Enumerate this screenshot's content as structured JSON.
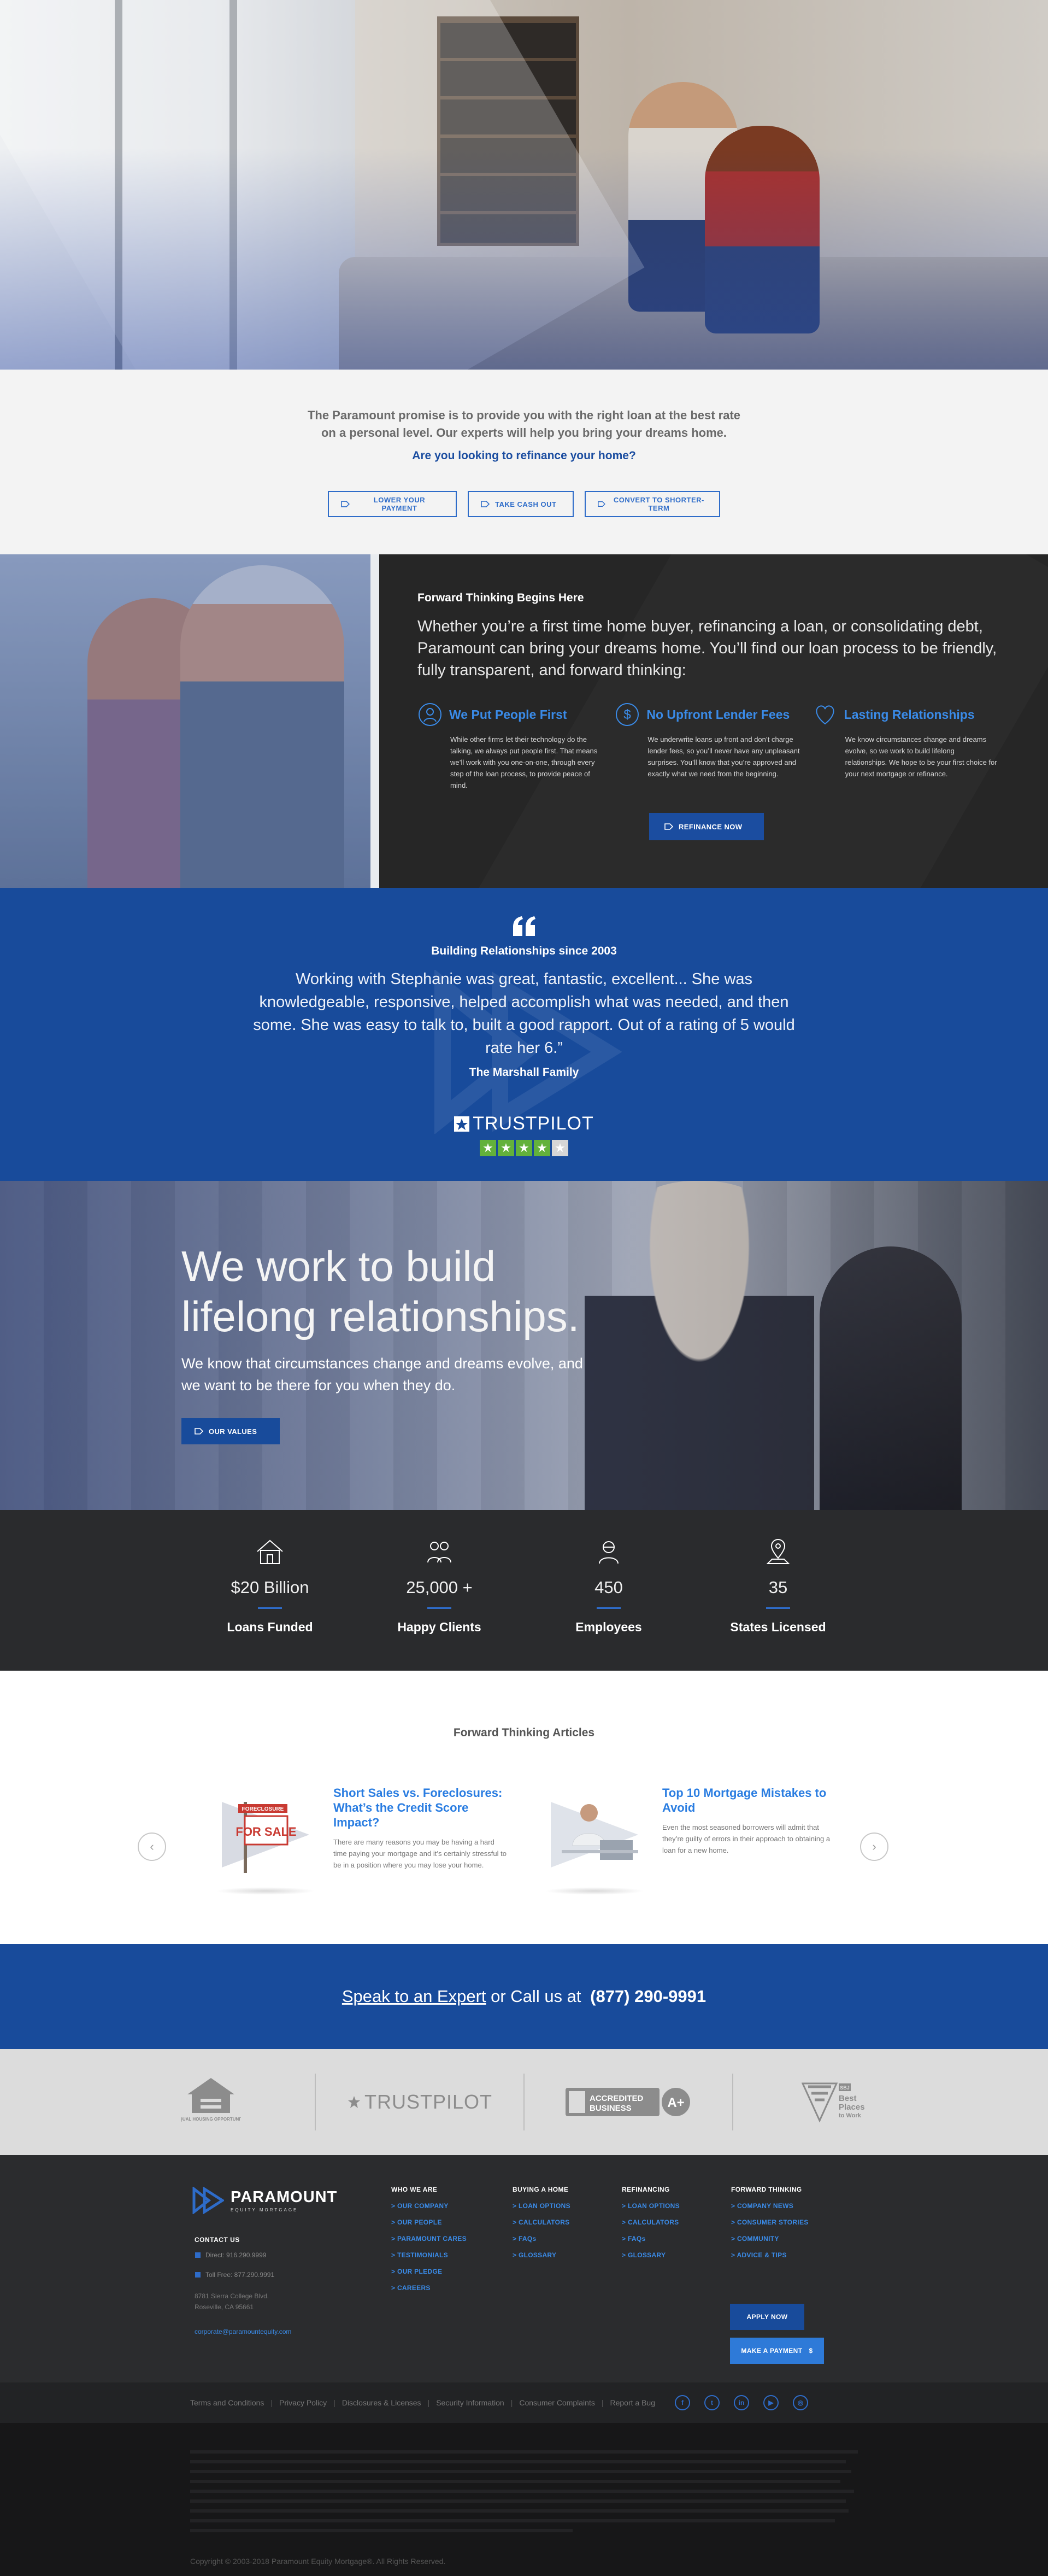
{
  "promise": {
    "text": "The Paramount promise is to provide you with the right loan at the best rate on a personal level. Our experts will help you bring your dreams home.",
    "question": "Are you looking to refinance your home?",
    "buttons": [
      "LOWER YOUR PAYMENT",
      "TAKE CASH OUT",
      "CONVERT TO SHORTER-TERM"
    ]
  },
  "forward": {
    "heading": "Forward Thinking Begins Here",
    "lead": "Whether you’re a first time home buyer, refinancing a loan, or consolidating debt, Paramount can bring your dreams home. You’ll find our loan process to be friendly, fully transparent, and forward thinking:",
    "columns": [
      {
        "title": "We Put People First",
        "icon": "people-icon",
        "text": "While other firms let their technology do the talking, we always put people first. That means we’ll work with you one-on-one, through every step of the loan process, to provide peace of mind."
      },
      {
        "title": "No Upfront Lender Fees",
        "icon": "dollar-icon",
        "text": "We underwrite loans up front and don’t charge lender fees, so you’ll never have any unpleasant surprises. You’ll know that you’re approved and exactly what we need from the beginning."
      },
      {
        "title": "Lasting Relationships",
        "icon": "heart-icon",
        "text": "We know circumstances change and dreams evolve, so we work to build lifelong relationships. We hope to be your first choice for your next mortgage or refinance."
      }
    ],
    "button": "REFINANCE NOW"
  },
  "testimonial": {
    "heading": "Building Relationships since 2003",
    "quote": "Working with Stephanie was great, fantastic, excellent... She was knowledgeable, responsive, helped accomplish what was needed, and then some. She was easy to talk to, built a good rapport. Out of a rating of 5 would rate her 6.”",
    "author": "The Marshall Family",
    "trustpilot": "TRUSTPILOT",
    "rating": 4,
    "rating_max": 5,
    "star_color": "#63b13b"
  },
  "relations": {
    "title_line1": "We work to build",
    "title_line2": "lifelong relationships.",
    "text": "We know that circumstances change and dreams evolve, and we want to be there for you when they do.",
    "button": "OUR VALUES"
  },
  "stats": [
    {
      "icon": "house-icon",
      "value": "$20 Billion",
      "label": "Loans Funded"
    },
    {
      "icon": "clients-icon",
      "value": "25,000 +",
      "label": "Happy Clients"
    },
    {
      "icon": "employee-icon",
      "value": "450",
      "label": "Employees"
    },
    {
      "icon": "map-pin-icon",
      "value": "35",
      "label": "States Licensed"
    }
  ],
  "articles": {
    "heading": "Forward Thinking Articles",
    "items": [
      {
        "title": "Short Sales vs. Foreclosures: What’s the Credit Score Impact?",
        "excerpt": "There are many reasons you may be having a hard time paying your mortgage and it’s certainly stressful to be in a position where you may lose your home.",
        "sign_top": "FORECLOSURE",
        "sign_main": "FOR SALE"
      },
      {
        "title": "Top 10 Mortgage Mistakes to Avoid",
        "excerpt": "Even the most seasoned borrowers will admit that they’re guilty of errors in their approach to obtaining a loan for a new home."
      }
    ]
  },
  "cta": {
    "link": "Speak to an Expert",
    "middle": " or Call us at ",
    "phone": "(877) 290-9991"
  },
  "badges": {
    "eho": "EQUAL HOUSING OPPORTUNITY",
    "trustpilot": "TRUSTPILOT",
    "bbb_line1": "ACCREDITED",
    "bbb_line2": "BUSINESS",
    "bbb_grade": "A+",
    "bpw_line1": "Best",
    "bpw_line2": "Places",
    "bpw_line3": "to Work",
    "bpw_abbr": "SBJ"
  },
  "footer": {
    "logo_name": "PARAMOUNT",
    "logo_sub": "EQUITY MORTGAGE",
    "contact_heading": "CONTACT US",
    "direct": "Direct: 916.290.9999",
    "tollfree": "Toll Free: 877.290.9991",
    "address1": "8781 Sierra College Blvd.",
    "address2": "Roseville, CA 95661",
    "email": "corporate@paramountequity.com",
    "menus": [
      {
        "heading": "WHO WE ARE",
        "items": [
          "OUR COMPANY",
          "OUR PEOPLE",
          "PARAMOUNT CARES",
          "TESTIMONIALS",
          "OUR PLEDGE",
          "CAREERS"
        ]
      },
      {
        "heading": "BUYING A HOME",
        "items": [
          "LOAN OPTIONS",
          "CALCULATORS",
          "FAQs",
          "GLOSSARY"
        ]
      },
      {
        "heading": "REFINANCING",
        "items": [
          "LOAN OPTIONS",
          "CALCULATORS",
          "FAQs",
          "GLOSSARY"
        ]
      },
      {
        "heading": "FORWARD THINKING",
        "items": [
          "COMPANY NEWS",
          "CONSUMER STORIES",
          "COMMUNITY",
          "ADVICE & TIPS"
        ]
      }
    ],
    "apply_button": "APPLY NOW",
    "payment_button": "MAKE A PAYMENT",
    "legal_links": [
      "Terms and Conditions",
      "Privacy Policy",
      "Disclosures & Licenses",
      "Security Information",
      "Consumer Complaints",
      "Report a Bug"
    ],
    "social": [
      "f",
      "t",
      "in",
      "▶",
      "◎"
    ],
    "copyright": "Copyright © 2003-2018 Paramount Equity Mortgage®. All Rights Reserved."
  },
  "colors": {
    "brand_blue": "#184b9b",
    "link_blue": "#3a8be8",
    "dark": "#2a2b2d"
  }
}
